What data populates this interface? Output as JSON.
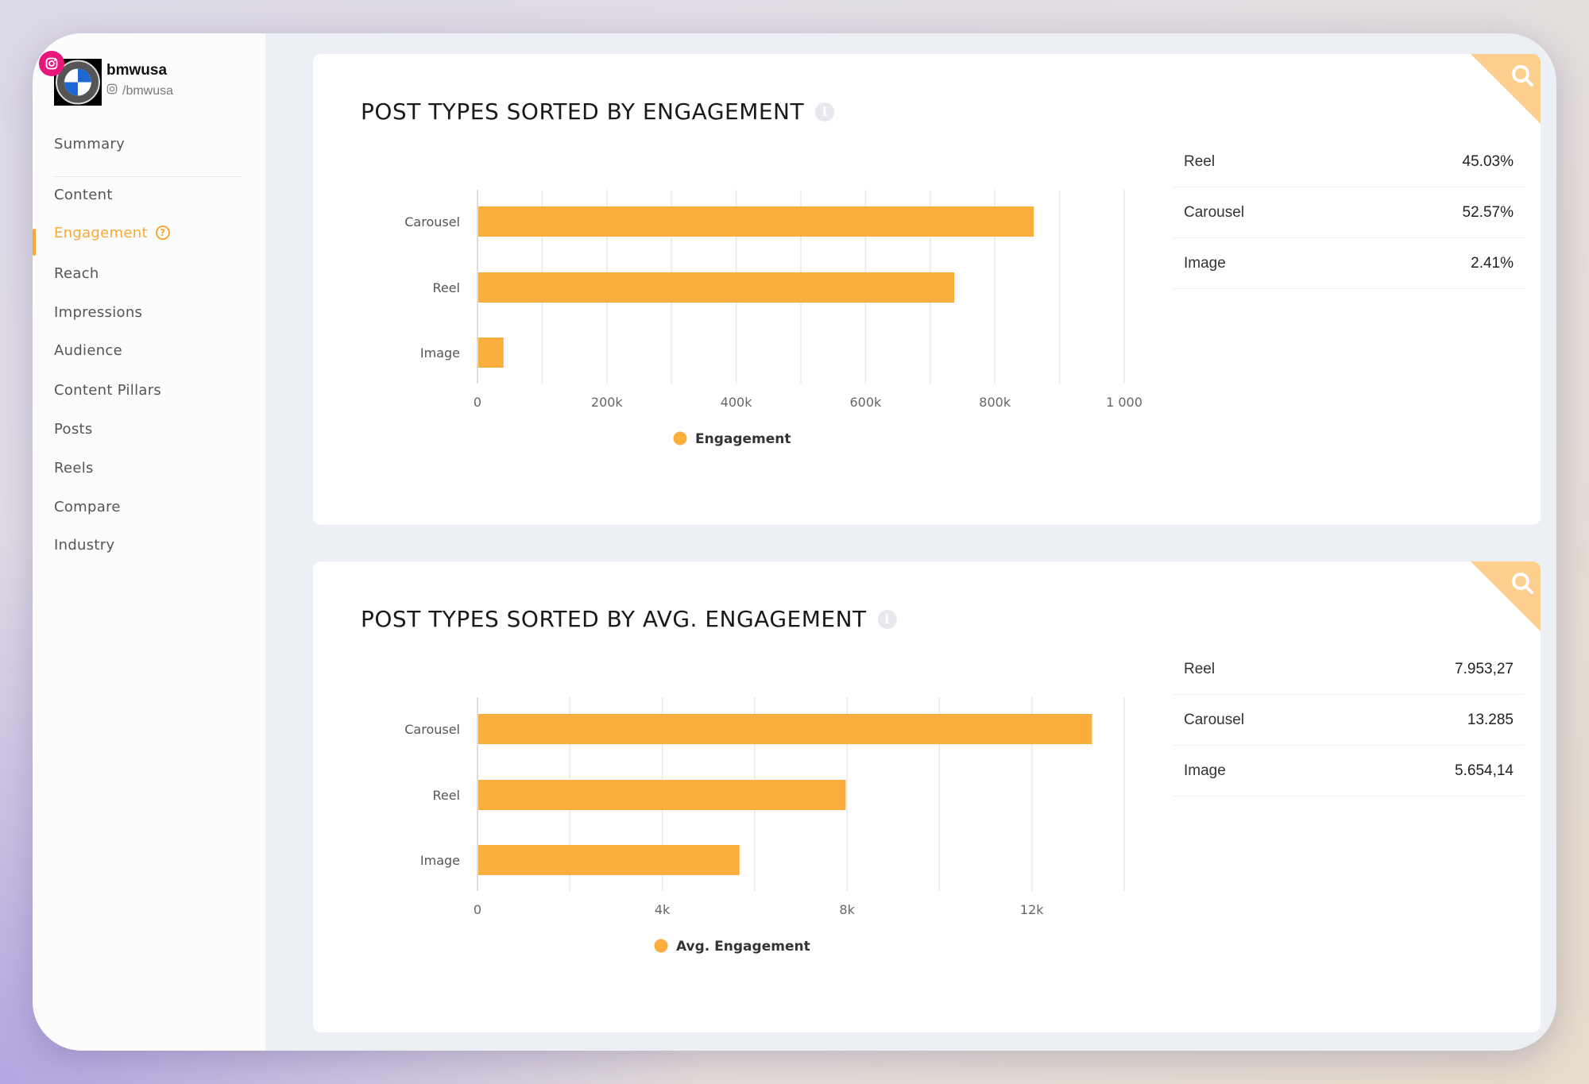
{
  "profile": {
    "name": "bmwusa",
    "handle": "/bmwusa",
    "platform_icon": "instagram-icon"
  },
  "sidebar": {
    "items": [
      {
        "label": "Summary"
      },
      {
        "label": "Content"
      },
      {
        "label": "Engagement",
        "active": true
      },
      {
        "label": "Reach"
      },
      {
        "label": "Impressions"
      },
      {
        "label": "Audience"
      },
      {
        "label": "Content Pillars"
      },
      {
        "label": "Posts"
      },
      {
        "label": "Reels"
      },
      {
        "label": "Compare"
      },
      {
        "label": "Industry"
      }
    ]
  },
  "colors": {
    "accent": "#f7a934",
    "bar": "#fbae3c",
    "corner": "#fccf8e"
  },
  "cards": [
    {
      "title": "POST TYPES SORTED BY ENGAGEMENT",
      "table": [
        {
          "label": "Reel",
          "value": "45.03%"
        },
        {
          "label": "Carousel",
          "value": "52.57%"
        },
        {
          "label": "Image",
          "value": "2.41%"
        }
      ]
    },
    {
      "title": "POST TYPES SORTED BY AVG. ENGAGEMENT",
      "table": [
        {
          "label": "Reel",
          "value": "7.953,27"
        },
        {
          "label": "Carousel",
          "value": "13.285"
        },
        {
          "label": "Image",
          "value": "5.654,14"
        }
      ]
    }
  ],
  "chart_data": [
    {
      "type": "bar",
      "orientation": "horizontal",
      "categories": [
        "Carousel",
        "Reel",
        "Image"
      ],
      "series": [
        {
          "name": "Engagement",
          "values": [
            859000,
            736000,
            39000
          ]
        }
      ],
      "xlim": [
        0,
        1000000
      ],
      "ticks": [
        0,
        200000,
        400000,
        600000,
        800000,
        1000000
      ],
      "tick_labels": [
        "0",
        "200k",
        "400k",
        "600k",
        "800k",
        "1 000"
      ],
      "grid_step": 100000,
      "grid": true,
      "legend": "bottom"
    },
    {
      "type": "bar",
      "orientation": "horizontal",
      "categories": [
        "Carousel",
        "Reel",
        "Image"
      ],
      "series": [
        {
          "name": "Avg. Engagement",
          "values": [
            13285,
            7953.27,
            5654.14
          ]
        }
      ],
      "xlim": [
        0,
        14000
      ],
      "ticks": [
        0,
        4000,
        8000,
        12000
      ],
      "tick_labels": [
        "0",
        "4k",
        "8k",
        "12k"
      ],
      "grid_step": 2000,
      "grid": true,
      "legend": "bottom"
    }
  ]
}
